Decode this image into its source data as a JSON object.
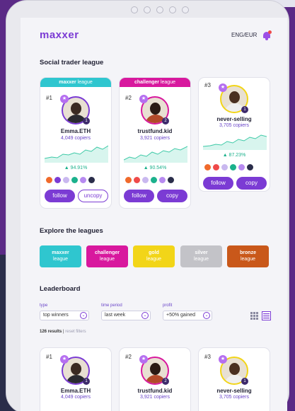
{
  "header": {
    "logo": "maxxer",
    "locale": "ENG/EUR"
  },
  "league_section": {
    "title": "Social trader league"
  },
  "top_cards": [
    {
      "band_brand": "maxxer",
      "band_suffix": "league",
      "band_color": "#2fc6cf",
      "rank": "#1",
      "name": "Emma.ETH",
      "copiers": "4,049 copiers",
      "pct": "▲ 94.91%",
      "badge": "1",
      "btn1": "follow",
      "btn2": "uncopy"
    },
    {
      "band_brand": "challenger",
      "band_suffix": "league",
      "band_color": "#d8189e",
      "rank": "#2",
      "name": "trustfund.kid",
      "copiers": "3,921 copiers",
      "pct": "▲ 90.54%",
      "badge": "2",
      "btn1": "follow",
      "btn2": "copy"
    },
    {
      "band_brand": "",
      "band_suffix": "",
      "band_color": "#ffffff",
      "rank": "#3",
      "name": "never-selling",
      "copiers": "3,705 copiers",
      "pct": "▲ 87.23%",
      "badge": "1",
      "btn1": "follow",
      "btn2": "copy"
    }
  ],
  "explore": {
    "title": "Explore the leagues",
    "leagues": [
      {
        "name": "maxxer",
        "sub": "league",
        "color": "#2fc6cf"
      },
      {
        "name": "challenger",
        "sub": "league",
        "color": "#d8189e"
      },
      {
        "name": "gold",
        "sub": "league",
        "color": "#f2d518"
      },
      {
        "name": "silver",
        "sub": "league",
        "color": "#c3c3c8"
      },
      {
        "name": "bronze",
        "sub": "league",
        "color": "#c9581a"
      }
    ]
  },
  "leaderboard": {
    "title": "Leaderboard",
    "filters": [
      {
        "label": "type",
        "value": "top winners"
      },
      {
        "label": "time period",
        "value": "last week"
      },
      {
        "label": "profit",
        "value": "+50% gained"
      }
    ],
    "results": "126 results",
    "reset": "reset filters",
    "cards": [
      {
        "rank": "#1",
        "name": "Emma.ETH",
        "copiers": "4,049 copiers",
        "badge": "1"
      },
      {
        "rank": "#2",
        "name": "trustfund.kid",
        "copiers": "3,921 copiers",
        "badge": "2"
      },
      {
        "rank": "#3",
        "name": "never-selling",
        "copiers": "3,705 copiers",
        "badge": "1"
      }
    ]
  },
  "colors": {
    "accent": "#7b3bd4",
    "positive": "#1bb18c"
  }
}
